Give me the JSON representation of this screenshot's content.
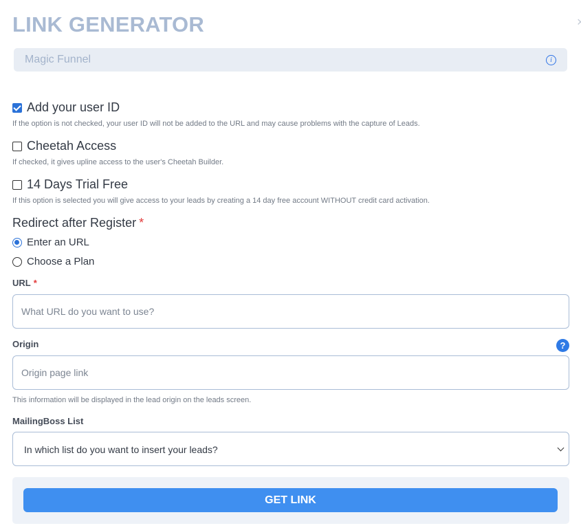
{
  "modal": {
    "title": "LINK GENERATOR",
    "close_symbol": "×",
    "funnel_name": "Magic Funnel",
    "info_icon": "info-icon"
  },
  "options": [
    {
      "label": "Add your user ID",
      "checked": true,
      "help": "If the option is not checked, your user ID will not be added to the URL and may cause problems with the capture of Leads."
    },
    {
      "label": "Cheetah Access",
      "checked": false,
      "help": "If checked, it gives upline access to the user's Cheetah Builder."
    },
    {
      "label": "14 Days Trial Free",
      "checked": false,
      "help": "If this option is selected you will give access to your leads by creating a 14 day free account WITHOUT credit card activation."
    }
  ],
  "redirect": {
    "label": "Redirect after Register",
    "required_mark": "*",
    "options": [
      {
        "label": "Enter an URL",
        "selected": true
      },
      {
        "label": "Choose a Plan",
        "selected": false
      }
    ]
  },
  "url_field": {
    "label": "URL",
    "required_mark": "*",
    "placeholder": "What URL do you want to use?",
    "value": ""
  },
  "origin_field": {
    "label": "Origin",
    "help_symbol": "?",
    "placeholder": "Origin page link",
    "value": "",
    "help": "This information will be displayed in the lead origin on the leads screen."
  },
  "mailing_list": {
    "label": "MailingBoss List",
    "selected": "In which list do you want to insert your leads?"
  },
  "actions": {
    "get_link_label": "GET LINK"
  },
  "colors": {
    "accent": "#2b72d8",
    "button": "#3f8ff0",
    "title": "#a9bad3",
    "required": "#e23b3b"
  }
}
